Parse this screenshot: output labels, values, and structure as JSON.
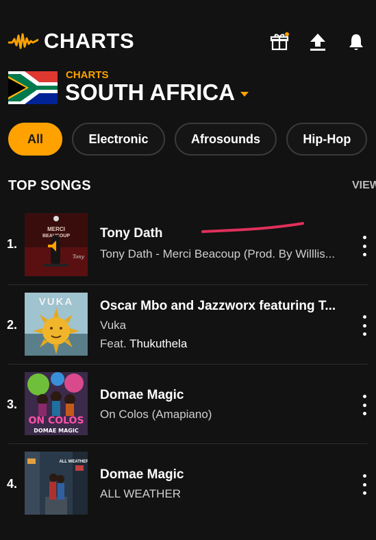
{
  "header": {
    "app_title": "CHARTS",
    "icons": [
      "audiomack-logo-icon",
      "gift-icon",
      "upload-icon",
      "bell-icon"
    ],
    "accent_color": "#ffa200"
  },
  "country": {
    "kicker": "CHARTS",
    "name": "SOUTH AFRICA"
  },
  "genres": [
    "All",
    "Electronic",
    "Afrosounds",
    "Hip-Hop"
  ],
  "genres_selected": "All",
  "section": {
    "title": "TOP SONGS",
    "view_all": "VIEW"
  },
  "songs": [
    {
      "rank": "1.",
      "artist": "Tony Dath",
      "title": "Tony Dath - Merci Beacoup (Prod. By Willlis...",
      "feat_label": "",
      "feat_artist": "",
      "art_text": "MERCI BEAUCOUP"
    },
    {
      "rank": "2.",
      "artist": "Oscar Mbo and Jazzworx featuring T...",
      "title": "Vuka",
      "feat_label": "Feat.",
      "feat_artist": "Thukuthela",
      "art_text": "VUKA"
    },
    {
      "rank": "3.",
      "artist": "Domae Magic",
      "title": "On Colos (Amapiano)",
      "feat_label": "",
      "feat_artist": "",
      "art_text": "ON COLOS DOMAE MAGIC"
    },
    {
      "rank": "4.",
      "artist": "Domae Magic",
      "title": "ALL WEATHER",
      "feat_label": "",
      "feat_artist": "",
      "art_text": "ALL WEATHER"
    }
  ]
}
